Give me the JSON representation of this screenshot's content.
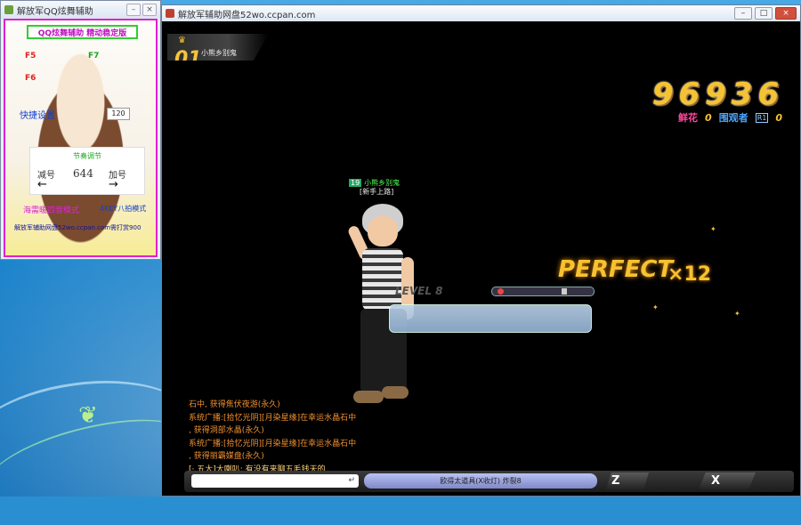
{
  "helper": {
    "title": "解放军QQ炫舞辅助",
    "header": "QQ炫舞辅助 精动稳定版",
    "hotkeys": [
      "F5",
      "F6",
      "F7"
    ],
    "quick_label": "快捷设置",
    "speed_value": "120",
    "adjust_title": "节奏调节",
    "dec_label": "减号",
    "adjust_value": "644",
    "inc_label": "加号",
    "arrow_left": "←",
    "arrow_right": "→",
    "mode_left": "海需暖四音模式",
    "mode_right": "4KEY八拍模式",
    "footer": "解放军辅助网盘52wo.ccpan.com需打赏900"
  },
  "game": {
    "title": "解放军辅助网盘52wo.ccpan.com",
    "rank": "01",
    "player_short": "小熊乡别鬼",
    "player_score": "96936",
    "score": "96936",
    "flowers_label": "鲜花",
    "flowers": "0",
    "viewers_label": "围观者",
    "viewers_rank": "R1",
    "viewers": "0",
    "dancer_name": "小熊乡别鬼",
    "dancer_vip": "19",
    "dancer_title": "[新手上路]",
    "level_text": "LEVEL 8",
    "judgement": "PERFECT",
    "combo": "×12",
    "chat": [
      "石中, 获得焦伏夜游(永久)",
      "系统广播:[拾忆光阴][月染星缘]在幸运水晶石中",
      ", 获得洞部水晶(永久)",
      "系统广播:[拾忆光阴][月染星缘]在幸运水晶石中",
      ", 获得丽霸媒盘(永久)",
      "[· 五大]大喇叭: 有没有来聊五毛钱天的"
    ],
    "chat_enter": "↵",
    "status_strip": "欧得太道具(X收灯)   炸裂8",
    "key_z": "Z",
    "key_x": "X"
  }
}
